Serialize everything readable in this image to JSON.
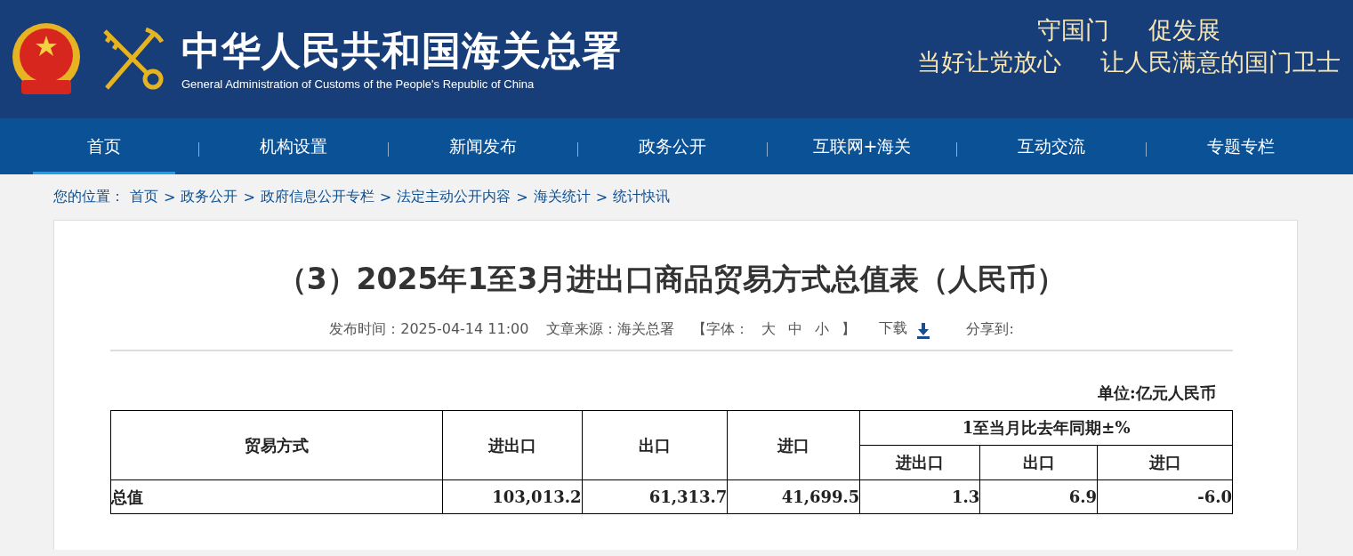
{
  "header": {
    "title": "中华人民共和国海关总署",
    "subtitle": "General Administration of Customs of the People's Republic of China",
    "slogans": [
      [
        "守国门",
        "促发展"
      ],
      [
        "当好让党放心",
        "让人民满意的国门卫士"
      ]
    ]
  },
  "nav": [
    {
      "label": "首页",
      "selected": true
    },
    {
      "label": "机构设置",
      "selected": false
    },
    {
      "label": "新闻发布",
      "selected": false
    },
    {
      "label": "政务公开",
      "selected": false
    },
    {
      "label": "互联网+海关",
      "selected": false
    },
    {
      "label": "互动交流",
      "selected": false
    },
    {
      "label": "专题专栏",
      "selected": false
    }
  ],
  "breadcrumb": {
    "label": "您的位置：",
    "separator": ">",
    "items": [
      "首页",
      "政务公开",
      "政府信息公开专栏",
      "法定主动公开内容",
      "海关统计",
      "统计快讯"
    ]
  },
  "article": {
    "title": "（3）2025年1至3月进出口商品贸易方式总值表（人民币）",
    "published": "发布时间：2025-04-14 11:00",
    "source": "文章来源：海关总署",
    "font_size": {
      "open": "【字体：",
      "sizes": [
        "大",
        "中",
        "小"
      ],
      "close": "】"
    },
    "download": "下载",
    "share": "分享到:"
  },
  "table": {
    "unit": "单位:亿元人民币",
    "columns": [
      "贸易方式",
      "进出口",
      "出口",
      "进口"
    ],
    "group": "1至当月比去年同期±%",
    "subcolumns": [
      "进出口",
      "出口",
      "进口"
    ],
    "rows": [
      [
        "总值",
        "103,013.2",
        "61,313.7",
        "41,699.5",
        "1.3",
        "6.9",
        "-6.0"
      ]
    ]
  }
}
